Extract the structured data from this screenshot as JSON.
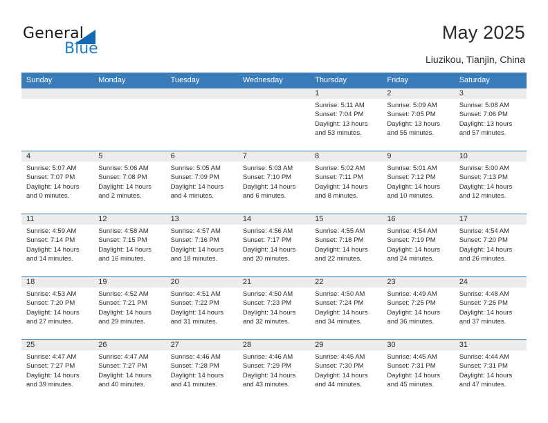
{
  "brand": {
    "name_part1": "General",
    "name_part2": "Blue",
    "triangle_color": "#1668b3",
    "blue_color": "#1f7fc4"
  },
  "header": {
    "title": "May 2025",
    "subtitle": "Liuzikou, Tianjin, China"
  },
  "theme": {
    "header_bg": "#3a7cba",
    "header_text": "#ffffff",
    "daynum_band_bg": "#ececec",
    "cell_bg": "#ffffff",
    "row_border": "#3a7cba",
    "text": "#2b2b2b"
  },
  "weekday_headers": [
    "Sunday",
    "Monday",
    "Tuesday",
    "Wednesday",
    "Thursday",
    "Friday",
    "Saturday"
  ],
  "weeks": [
    [
      {
        "day": "",
        "sunrise": "",
        "sunset": "",
        "daylight_line1": "",
        "daylight_line2": "",
        "empty": true
      },
      {
        "day": "",
        "sunrise": "",
        "sunset": "",
        "daylight_line1": "",
        "daylight_line2": "",
        "empty": true
      },
      {
        "day": "",
        "sunrise": "",
        "sunset": "",
        "daylight_line1": "",
        "daylight_line2": "",
        "empty": true
      },
      {
        "day": "",
        "sunrise": "",
        "sunset": "",
        "daylight_line1": "",
        "daylight_line2": "",
        "empty": true
      },
      {
        "day": "1",
        "sunrise": "Sunrise: 5:11 AM",
        "sunset": "Sunset: 7:04 PM",
        "daylight_line1": "Daylight: 13 hours",
        "daylight_line2": "and 53 minutes."
      },
      {
        "day": "2",
        "sunrise": "Sunrise: 5:09 AM",
        "sunset": "Sunset: 7:05 PM",
        "daylight_line1": "Daylight: 13 hours",
        "daylight_line2": "and 55 minutes."
      },
      {
        "day": "3",
        "sunrise": "Sunrise: 5:08 AM",
        "sunset": "Sunset: 7:06 PM",
        "daylight_line1": "Daylight: 13 hours",
        "daylight_line2": "and 57 minutes."
      }
    ],
    [
      {
        "day": "4",
        "sunrise": "Sunrise: 5:07 AM",
        "sunset": "Sunset: 7:07 PM",
        "daylight_line1": "Daylight: 14 hours",
        "daylight_line2": "and 0 minutes."
      },
      {
        "day": "5",
        "sunrise": "Sunrise: 5:06 AM",
        "sunset": "Sunset: 7:08 PM",
        "daylight_line1": "Daylight: 14 hours",
        "daylight_line2": "and 2 minutes."
      },
      {
        "day": "6",
        "sunrise": "Sunrise: 5:05 AM",
        "sunset": "Sunset: 7:09 PM",
        "daylight_line1": "Daylight: 14 hours",
        "daylight_line2": "and 4 minutes."
      },
      {
        "day": "7",
        "sunrise": "Sunrise: 5:03 AM",
        "sunset": "Sunset: 7:10 PM",
        "daylight_line1": "Daylight: 14 hours",
        "daylight_line2": "and 6 minutes."
      },
      {
        "day": "8",
        "sunrise": "Sunrise: 5:02 AM",
        "sunset": "Sunset: 7:11 PM",
        "daylight_line1": "Daylight: 14 hours",
        "daylight_line2": "and 8 minutes."
      },
      {
        "day": "9",
        "sunrise": "Sunrise: 5:01 AM",
        "sunset": "Sunset: 7:12 PM",
        "daylight_line1": "Daylight: 14 hours",
        "daylight_line2": "and 10 minutes."
      },
      {
        "day": "10",
        "sunrise": "Sunrise: 5:00 AM",
        "sunset": "Sunset: 7:13 PM",
        "daylight_line1": "Daylight: 14 hours",
        "daylight_line2": "and 12 minutes."
      }
    ],
    [
      {
        "day": "11",
        "sunrise": "Sunrise: 4:59 AM",
        "sunset": "Sunset: 7:14 PM",
        "daylight_line1": "Daylight: 14 hours",
        "daylight_line2": "and 14 minutes."
      },
      {
        "day": "12",
        "sunrise": "Sunrise: 4:58 AM",
        "sunset": "Sunset: 7:15 PM",
        "daylight_line1": "Daylight: 14 hours",
        "daylight_line2": "and 16 minutes."
      },
      {
        "day": "13",
        "sunrise": "Sunrise: 4:57 AM",
        "sunset": "Sunset: 7:16 PM",
        "daylight_line1": "Daylight: 14 hours",
        "daylight_line2": "and 18 minutes."
      },
      {
        "day": "14",
        "sunrise": "Sunrise: 4:56 AM",
        "sunset": "Sunset: 7:17 PM",
        "daylight_line1": "Daylight: 14 hours",
        "daylight_line2": "and 20 minutes."
      },
      {
        "day": "15",
        "sunrise": "Sunrise: 4:55 AM",
        "sunset": "Sunset: 7:18 PM",
        "daylight_line1": "Daylight: 14 hours",
        "daylight_line2": "and 22 minutes."
      },
      {
        "day": "16",
        "sunrise": "Sunrise: 4:54 AM",
        "sunset": "Sunset: 7:19 PM",
        "daylight_line1": "Daylight: 14 hours",
        "daylight_line2": "and 24 minutes."
      },
      {
        "day": "17",
        "sunrise": "Sunrise: 4:54 AM",
        "sunset": "Sunset: 7:20 PM",
        "daylight_line1": "Daylight: 14 hours",
        "daylight_line2": "and 26 minutes."
      }
    ],
    [
      {
        "day": "18",
        "sunrise": "Sunrise: 4:53 AM",
        "sunset": "Sunset: 7:20 PM",
        "daylight_line1": "Daylight: 14 hours",
        "daylight_line2": "and 27 minutes."
      },
      {
        "day": "19",
        "sunrise": "Sunrise: 4:52 AM",
        "sunset": "Sunset: 7:21 PM",
        "daylight_line1": "Daylight: 14 hours",
        "daylight_line2": "and 29 minutes."
      },
      {
        "day": "20",
        "sunrise": "Sunrise: 4:51 AM",
        "sunset": "Sunset: 7:22 PM",
        "daylight_line1": "Daylight: 14 hours",
        "daylight_line2": "and 31 minutes."
      },
      {
        "day": "21",
        "sunrise": "Sunrise: 4:50 AM",
        "sunset": "Sunset: 7:23 PM",
        "daylight_line1": "Daylight: 14 hours",
        "daylight_line2": "and 32 minutes."
      },
      {
        "day": "22",
        "sunrise": "Sunrise: 4:50 AM",
        "sunset": "Sunset: 7:24 PM",
        "daylight_line1": "Daylight: 14 hours",
        "daylight_line2": "and 34 minutes."
      },
      {
        "day": "23",
        "sunrise": "Sunrise: 4:49 AM",
        "sunset": "Sunset: 7:25 PM",
        "daylight_line1": "Daylight: 14 hours",
        "daylight_line2": "and 36 minutes."
      },
      {
        "day": "24",
        "sunrise": "Sunrise: 4:48 AM",
        "sunset": "Sunset: 7:26 PM",
        "daylight_line1": "Daylight: 14 hours",
        "daylight_line2": "and 37 minutes."
      }
    ],
    [
      {
        "day": "25",
        "sunrise": "Sunrise: 4:47 AM",
        "sunset": "Sunset: 7:27 PM",
        "daylight_line1": "Daylight: 14 hours",
        "daylight_line2": "and 39 minutes."
      },
      {
        "day": "26",
        "sunrise": "Sunrise: 4:47 AM",
        "sunset": "Sunset: 7:27 PM",
        "daylight_line1": "Daylight: 14 hours",
        "daylight_line2": "and 40 minutes."
      },
      {
        "day": "27",
        "sunrise": "Sunrise: 4:46 AM",
        "sunset": "Sunset: 7:28 PM",
        "daylight_line1": "Daylight: 14 hours",
        "daylight_line2": "and 41 minutes."
      },
      {
        "day": "28",
        "sunrise": "Sunrise: 4:46 AM",
        "sunset": "Sunset: 7:29 PM",
        "daylight_line1": "Daylight: 14 hours",
        "daylight_line2": "and 43 minutes."
      },
      {
        "day": "29",
        "sunrise": "Sunrise: 4:45 AM",
        "sunset": "Sunset: 7:30 PM",
        "daylight_line1": "Daylight: 14 hours",
        "daylight_line2": "and 44 minutes."
      },
      {
        "day": "30",
        "sunrise": "Sunrise: 4:45 AM",
        "sunset": "Sunset: 7:31 PM",
        "daylight_line1": "Daylight: 14 hours",
        "daylight_line2": "and 45 minutes."
      },
      {
        "day": "31",
        "sunrise": "Sunrise: 4:44 AM",
        "sunset": "Sunset: 7:31 PM",
        "daylight_line1": "Daylight: 14 hours",
        "daylight_line2": "and 47 minutes."
      }
    ]
  ]
}
